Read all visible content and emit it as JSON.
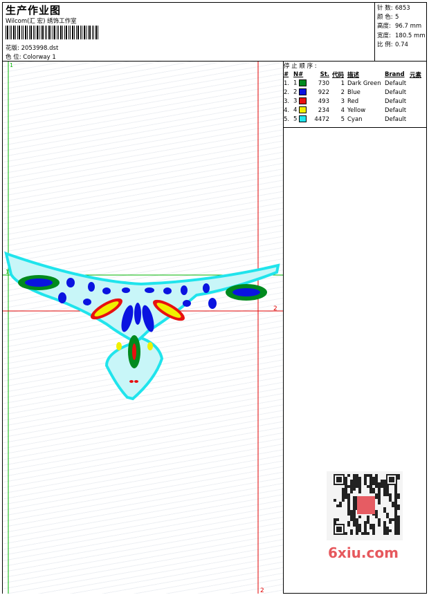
{
  "header": {
    "title": "生产作业图",
    "company": "Wilcom(汇 宏) 绣饰工作室",
    "design_label": "花版:",
    "design_value": "2053998.dst",
    "colorway_label": "色 位:",
    "colorway_value": "Colorway 1"
  },
  "stats": [
    {
      "label": "针 数:",
      "value": "6853"
    },
    {
      "label": "颜 色:",
      "value": "5"
    },
    {
      "label": "高度:",
      "value": "96.7 mm"
    },
    {
      "label": "宽度:",
      "value": "180.5 mm"
    },
    {
      "label": "比 例:",
      "value": "0.74"
    }
  ],
  "stop_sequence": {
    "title": "停 止 顺 序 :",
    "columns": [
      "#",
      "N#",
      "St.",
      "代码",
      "描述",
      "Brand",
      "元素"
    ],
    "rows": [
      {
        "num": "1.",
        "n": "1",
        "color": "#008a1e",
        "stitches": "730",
        "code": "1",
        "desc": "Dark Green",
        "brand": "Default"
      },
      {
        "num": "2.",
        "n": "2",
        "color": "#0a14e0",
        "stitches": "922",
        "code": "2",
        "desc": "Blue",
        "brand": "Default"
      },
      {
        "num": "3.",
        "n": "3",
        "color": "#e81010",
        "stitches": "493",
        "code": "3",
        "desc": "Red",
        "brand": "Default"
      },
      {
        "num": "4.",
        "n": "4",
        "color": "#f0f000",
        "stitches": "234",
        "code": "4",
        "desc": "Yellow",
        "brand": "Default"
      },
      {
        "num": "5.",
        "n": "5",
        "color": "#20e4ec",
        "stitches": "4472",
        "code": "5",
        "desc": "Cyan",
        "brand": "Default"
      }
    ]
  },
  "markers": {
    "green_top": "1",
    "green_left": "1",
    "red_right": "2",
    "red_bottom": "2"
  },
  "watermark": "6xiu.com",
  "colors": {
    "green_guide": "#00b400",
    "red_guide": "#e00000",
    "cyan": "#20e4ec"
  }
}
